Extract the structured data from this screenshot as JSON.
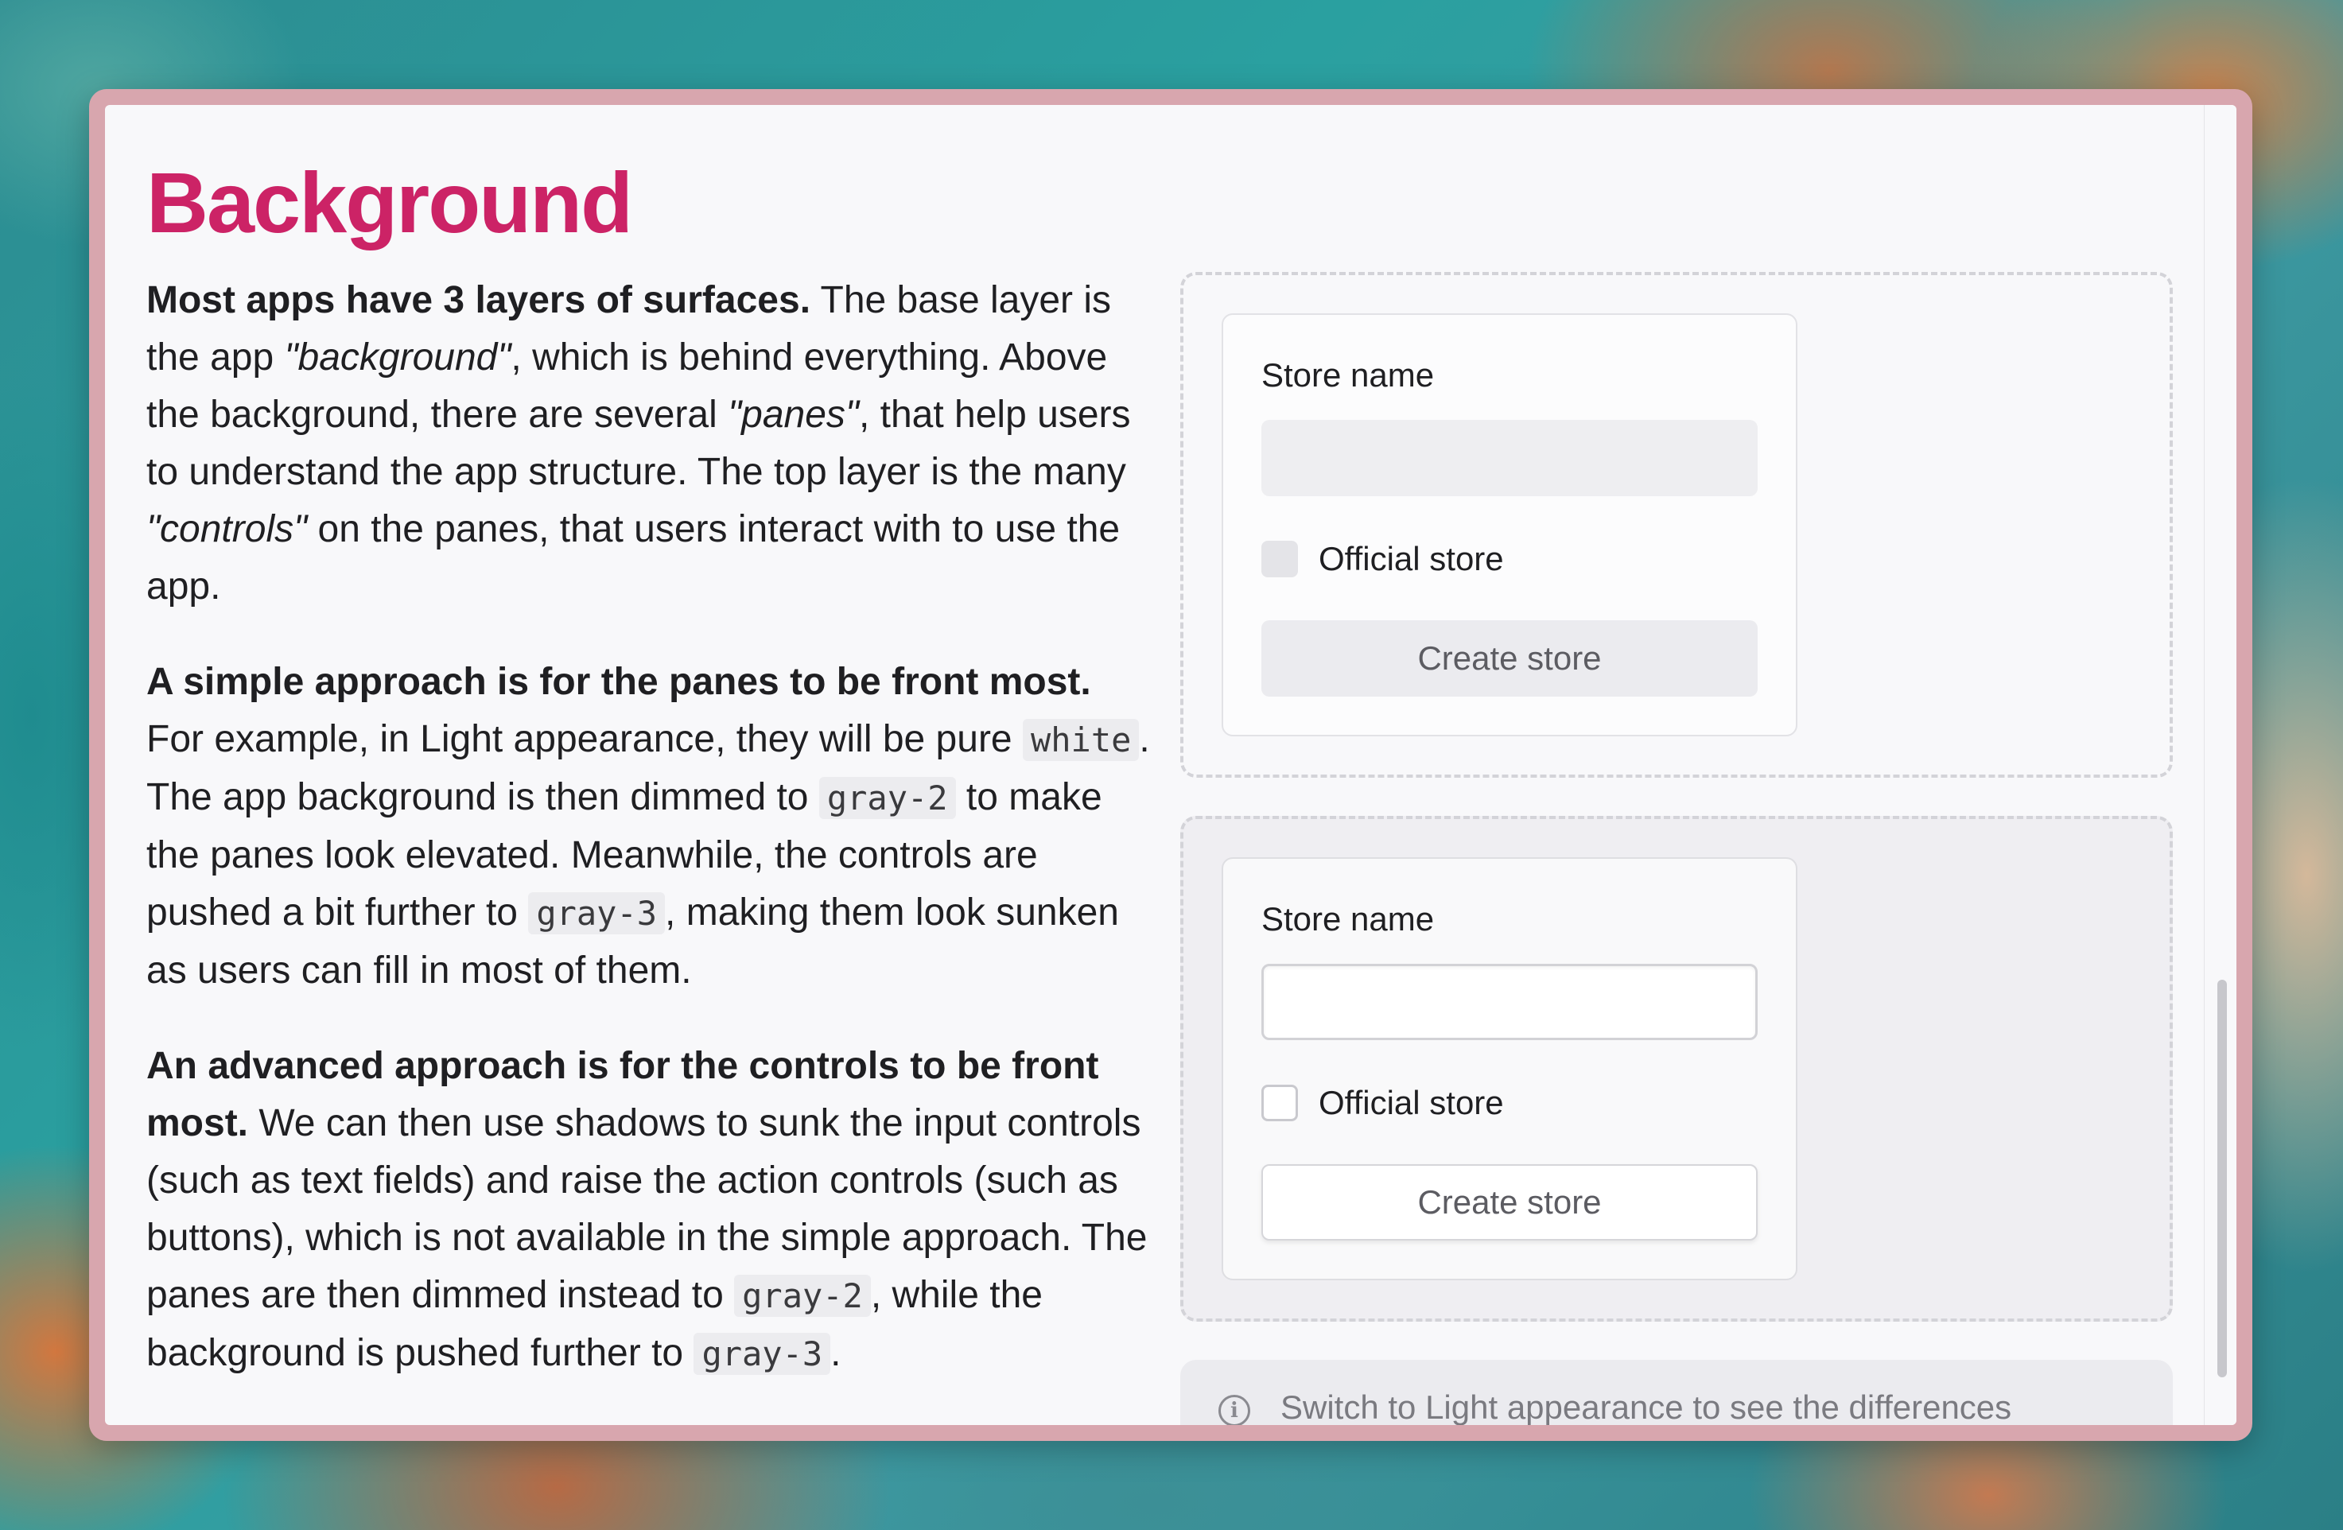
{
  "page": {
    "title": "Background"
  },
  "paragraphs": {
    "p1": {
      "bold": "Most apps have 3 layers of surfaces.",
      "t1": " The base layer is the app ",
      "i1": "\"background\"",
      "t2": ", which is behind everything. Above the background, there are several ",
      "i2": "\"panes\"",
      "t3": ", that help users to understand the app structure. The top layer is the many ",
      "i3": "\"controls\"",
      "t4": " on the panes, that users interact with to use the app."
    },
    "p2": {
      "bold": "A simple approach is for the panes to be front most.",
      "t1": " For example, in Light appearance, they will be pure ",
      "c1": "white",
      "t2": ". The app background is then dimmed to ",
      "c2": "gray-2",
      "t3": " to make the panes look elevated. Meanwhile, the controls are pushed a bit further to ",
      "c3": "gray-3",
      "t4": ", making them look sunken as users can fill in most of them."
    },
    "p3": {
      "bold": "An advanced approach is for the controls to be front most.",
      "t1": " We can then use shadows to sunk the input controls (such as text fields) and raise the action controls (such as buttons), which is not available in the simple approach. The panes are then dimmed instead to ",
      "c1": "gray-2",
      "t2": ", while the background is pushed further to ",
      "c2": "gray-3",
      "t3": "."
    }
  },
  "demo_simple": {
    "field_label": "Store name",
    "input_value": "",
    "checkbox_label": "Official store",
    "button_label": "Create store"
  },
  "demo_advanced": {
    "field_label": "Store name",
    "input_value": "",
    "checkbox_label": "Official store",
    "button_label": "Create store"
  },
  "note": {
    "icon": "info-icon",
    "icon_glyph": "i",
    "text": "Switch to Light appearance to see the differences"
  },
  "colors": {
    "title": "#cc2366",
    "window_border": "#d8a6ae",
    "content_bg": "#f8f8fa"
  }
}
